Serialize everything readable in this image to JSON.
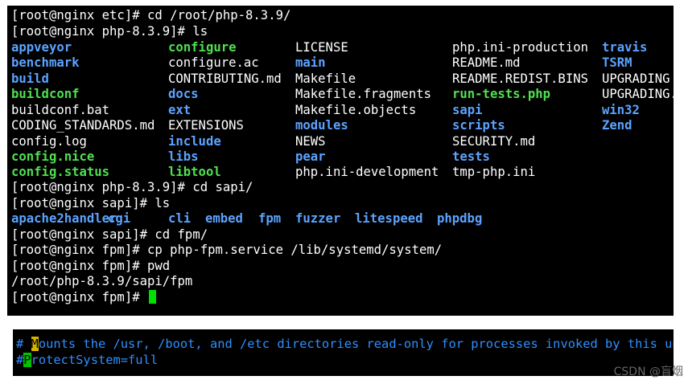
{
  "terminal": {
    "prompt_lines_top": [
      "[root@nginx etc]# cd /root/php-8.3.9/",
      "[root@nginx php-8.3.9]# ls"
    ],
    "ls_grid": [
      [
        [
          "appveyor",
          "blue"
        ],
        [
          "configure",
          "green"
        ],
        [
          "LICENSE",
          "white"
        ],
        [
          "php.ini-production",
          "white"
        ],
        [
          "travis",
          "blue"
        ]
      ],
      [
        [
          "benchmark",
          "blue"
        ],
        [
          "configure.ac",
          "white"
        ],
        [
          "main",
          "blue"
        ],
        [
          "README.md",
          "white"
        ],
        [
          "TSRM",
          "blue"
        ]
      ],
      [
        [
          "build",
          "blue"
        ],
        [
          "CONTRIBUTING.md",
          "white"
        ],
        [
          "Makefile",
          "white"
        ],
        [
          "README.REDIST.BINS",
          "white"
        ],
        [
          "UPGRADING",
          "white"
        ]
      ],
      [
        [
          "buildconf",
          "green"
        ],
        [
          "docs",
          "blue"
        ],
        [
          "Makefile.fragments",
          "white"
        ],
        [
          "run-tests.php",
          "green"
        ],
        [
          "UPGRADING.",
          "white"
        ]
      ],
      [
        [
          "buildconf.bat",
          "white"
        ],
        [
          "ext",
          "blue"
        ],
        [
          "Makefile.objects",
          "white"
        ],
        [
          "sapi",
          "blue"
        ],
        [
          "win32",
          "blue"
        ]
      ],
      [
        [
          "CODING_STANDARDS.md",
          "white"
        ],
        [
          "EXTENSIONS",
          "white"
        ],
        [
          "modules",
          "blue"
        ],
        [
          "scripts",
          "blue"
        ],
        [
          "Zend",
          "blue"
        ]
      ],
      [
        [
          "config.log",
          "white"
        ],
        [
          "include",
          "blue"
        ],
        [
          "NEWS",
          "white"
        ],
        [
          "SECURITY.md",
          "white"
        ],
        [
          "",
          ""
        ]
      ],
      [
        [
          "config.nice",
          "green"
        ],
        [
          "libs",
          "blue"
        ],
        [
          "pear",
          "blue"
        ],
        [
          "tests",
          "blue"
        ],
        [
          "",
          ""
        ]
      ],
      [
        [
          "config.status",
          "green"
        ],
        [
          "libtool",
          "green"
        ],
        [
          "php.ini-development",
          "white"
        ],
        [
          "tmp-php.ini",
          "white"
        ],
        [
          "",
          ""
        ]
      ]
    ],
    "cmd_cd_sapi": "[root@nginx php-8.3.9]# cd sapi/",
    "cmd_ls_sapi": "[root@nginx sapi]# ls",
    "sapi_items": [
      "apache2handler",
      "cgi",
      "cli",
      "embed",
      "fpm",
      "fuzzer",
      "litespeed",
      "phpdbg"
    ],
    "cmd_cd_fpm": "[root@nginx sapi]# cd fpm/",
    "cmd_cp": "[root@nginx fpm]# cp php-fpm.service /lib/systemd/system/",
    "cmd_pwd": "[root@nginx fpm]# pwd",
    "pwd_output": "/root/php-8.3.9/sapi/fpm",
    "final_prompt": "[root@nginx fpm]# "
  },
  "vim": {
    "line1_prefix": "# ",
    "line1_hl": "M",
    "line1_rest": "ounts the /usr, /boot, and /etc directories read-only for processes invoked by this un",
    "line2_prefix": "#",
    "line2_hl": "P",
    "line2_rest": "rotectSystem=full"
  },
  "watermark": "CSDN @盲烟",
  "colors": {
    "dir_blue": "#5ca3ff",
    "exec_green": "#4fe04f",
    "comment_blue": "#2f8fff",
    "cursor_green": "#00e000"
  }
}
